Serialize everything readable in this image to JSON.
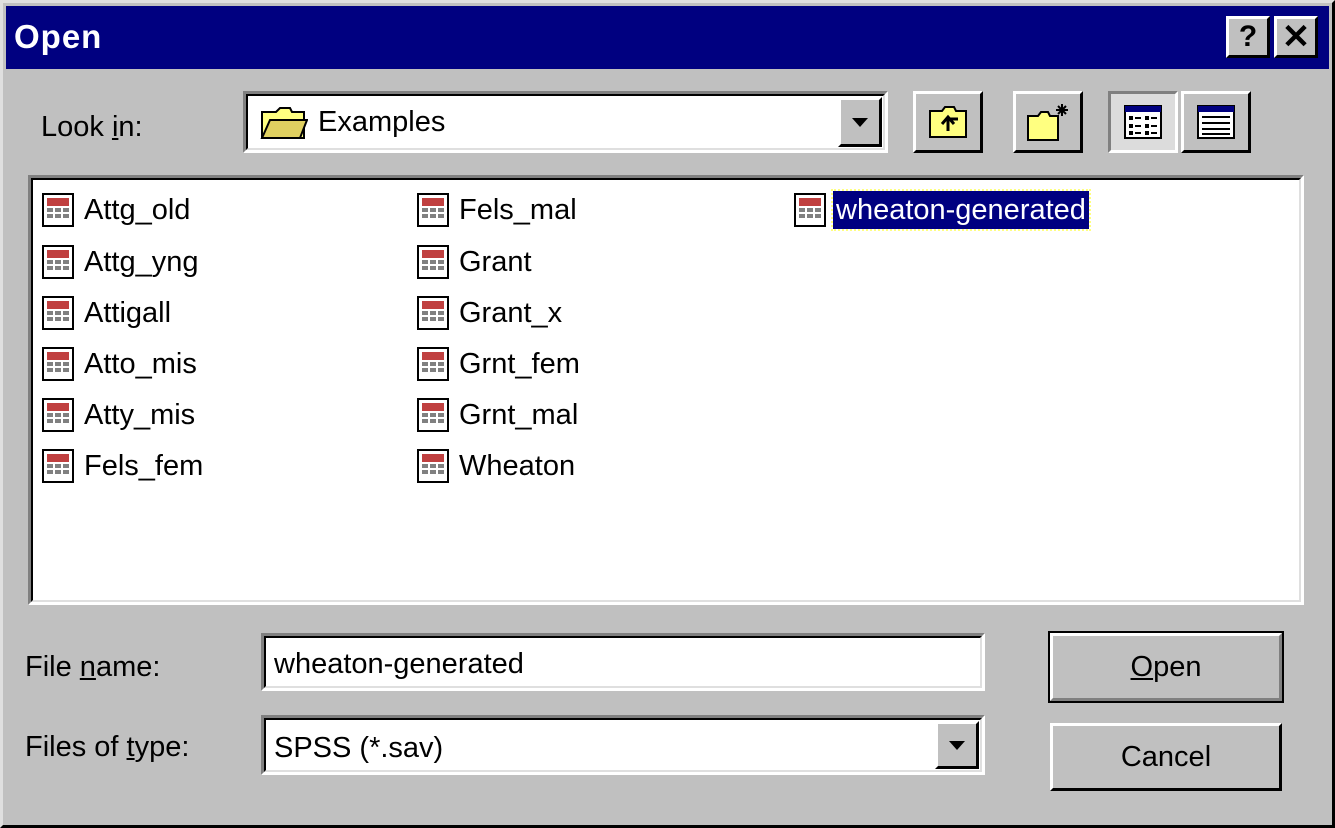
{
  "dialog": {
    "title": "Open",
    "help_glyph": "?",
    "close_glyph": "✕"
  },
  "look_in": {
    "label": "Look in:",
    "value": "Examples"
  },
  "files": [
    {
      "name": "Attg_old",
      "selected": false
    },
    {
      "name": "Attg_yng",
      "selected": false
    },
    {
      "name": "Attigall",
      "selected": false
    },
    {
      "name": "Atto_mis",
      "selected": false
    },
    {
      "name": "Atty_mis",
      "selected": false
    },
    {
      "name": "Fels_fem",
      "selected": false
    },
    {
      "name": "Fels_mal",
      "selected": false
    },
    {
      "name": "Grant",
      "selected": false
    },
    {
      "name": "Grant_x",
      "selected": false
    },
    {
      "name": "Grnt_fem",
      "selected": false
    },
    {
      "name": "Grnt_mal",
      "selected": false
    },
    {
      "name": "Wheaton",
      "selected": false
    },
    {
      "name": "wheaton-generated",
      "selected": true
    }
  ],
  "file_name": {
    "label": "File name:",
    "value": "wheaton-generated"
  },
  "file_type": {
    "label": "Files of type:",
    "value": "SPSS (*.sav)"
  },
  "buttons": {
    "open": "Open",
    "cancel": "Cancel"
  },
  "colors": {
    "titlebar": "#000080",
    "face": "#c0c0c0",
    "selection": "#000080"
  },
  "icons": {
    "folder": "folder-icon",
    "up_one_level": "up-folder-icon",
    "new_folder": "new-folder-icon",
    "list_view": "list-view-icon",
    "details_view": "details-view-icon",
    "file": "spss-data-file-icon"
  }
}
